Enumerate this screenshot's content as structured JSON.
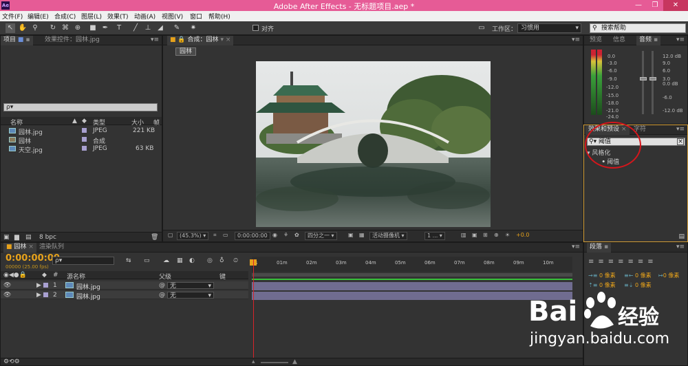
{
  "app": {
    "title": "Adobe After Effects - 无标题项目.aep *",
    "icon": "Ae",
    "window_controls": [
      "—",
      "❐",
      "✕"
    ]
  },
  "menu": [
    "文件(F)",
    "编辑(E)",
    "合成(C)",
    "图层(L)",
    "效果(T)",
    "动画(A)",
    "视图(V)",
    "窗口",
    "帮助(H)"
  ],
  "toolbar": {
    "snap_label": "对齐",
    "workspace_label": "工作区：",
    "workspace_value": "习惯用",
    "help_search": "搜索帮助"
  },
  "project_panel": {
    "tabs": [
      "项目",
      "效果控件：园林.jpg"
    ],
    "search_placeholder": "ρ▾",
    "columns": [
      "名称",
      "类型",
      "大小",
      "帧"
    ],
    "items": [
      {
        "name": "园林.jpg",
        "type": "JPEG",
        "size": "221 KB",
        "kind": "image",
        "color": "#a8a0d0"
      },
      {
        "name": "园林",
        "type": "合成",
        "size": "",
        "kind": "comp",
        "color": "#a8a0d0"
      },
      {
        "name": "天空.jpg",
        "type": "JPEG",
        "size": "63 KB",
        "kind": "image",
        "color": "#a8a0d0"
      }
    ],
    "footer_bpc": "8 bpc"
  },
  "composition_panel": {
    "tab": "合成：园林",
    "crumb": "园林",
    "footer": {
      "zoom": "(45.3%)",
      "timecode": "0:00:00:00",
      "resolution": "四分之一",
      "camera": "活动摄像机",
      "views": "1 ...",
      "exposure": "+0.0"
    }
  },
  "audio_panel": {
    "tabs": [
      "预览",
      "信息",
      "音频"
    ],
    "db_left": [
      "0.0",
      "-3.0",
      "-6.0",
      "-9.0",
      "-12.0",
      "-15.0",
      "-18.0",
      "-21.0",
      "-24.0"
    ],
    "db_right": [
      "12.0 dB",
      "9.0",
      "6.0",
      "3.0",
      "0.0 dB",
      "-6.0",
      "-12.0 dB"
    ]
  },
  "effects_panel": {
    "tabs": [
      "效果和预设",
      "字符"
    ],
    "search_value": "阈值",
    "category": "风格化",
    "effect": "阈值"
  },
  "paragraph_panel": {
    "tab": "段落",
    "fields": [
      "0 像素",
      "0 像素",
      "0 像素",
      "0 像素",
      "0 像素"
    ]
  },
  "timeline": {
    "tabs": [
      "园林",
      "渲染队列"
    ],
    "timecode": "0:00:00:00",
    "fps": "00000 (25.00 fps)",
    "search_placeholder": "ρ▾",
    "columns": {
      "num": "#",
      "source": "源名称",
      "parent": "父级",
      "key": "键"
    },
    "ruler": [
      "0s",
      "01m",
      "02m",
      "03m",
      "04m",
      "05m",
      "06m",
      "07m",
      "08m",
      "09m",
      "10m"
    ],
    "layers": [
      {
        "num": "1",
        "name": "园林.jpg",
        "parent": "无"
      },
      {
        "num": "2",
        "name": "园林.jpg",
        "parent": "无"
      }
    ]
  },
  "watermark": {
    "brand": "Bai",
    "brand2": "经验",
    "url": "jingyan.baidu.com"
  },
  "colors": {
    "title_bar": "#e65b96",
    "timecode": "#e7a21b",
    "annotation": "#d5161c",
    "layer_bar": "#7f7aa7"
  }
}
